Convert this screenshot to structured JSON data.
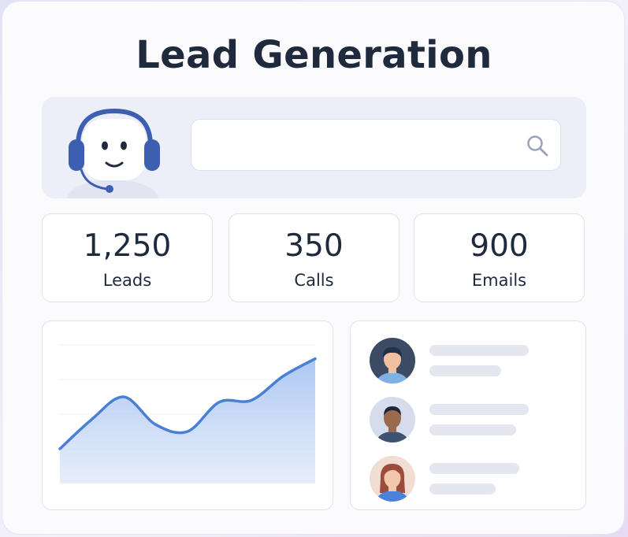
{
  "title": "Lead Generation",
  "search": {
    "value": "",
    "placeholder": ""
  },
  "icons": {
    "search": "search-icon",
    "assistant": "headset-robot-icon"
  },
  "stats": [
    {
      "value": "1,250",
      "label": "Leads"
    },
    {
      "value": "350",
      "label": "Calls"
    },
    {
      "value": "900",
      "label": "Emails"
    }
  ],
  "chart_data": {
    "type": "area",
    "x": [
      0,
      1,
      2,
      3,
      4,
      5,
      6,
      7,
      8
    ],
    "values": [
      20,
      37,
      50,
      34,
      30,
      47,
      48,
      62,
      72
    ],
    "ylim": [
      0,
      80
    ],
    "title": "",
    "xlabel": "",
    "ylabel": "",
    "grid": true,
    "color": "#4a7fd6"
  },
  "contacts": [
    {
      "avatar": "man-avatar-icon",
      "bg": "#3a4b63",
      "shirt": "#7fb0e6",
      "skin": "#f0c1a0",
      "hair": "#22304a"
    },
    {
      "avatar": "man-avatar-icon",
      "bg": "#d5dceb",
      "shirt": "#3e5372",
      "skin": "#9b6a4e",
      "hair": "#1f2533"
    },
    {
      "avatar": "woman-avatar-icon",
      "bg": "#f1ddd2",
      "shirt": "#4a82da",
      "skin": "#f3c6ae",
      "hair": "#9b4c3b"
    }
  ],
  "colors": {
    "accent": "#4a7fd6",
    "text": "#1f2a3d",
    "headset": "#3d5fb2"
  }
}
